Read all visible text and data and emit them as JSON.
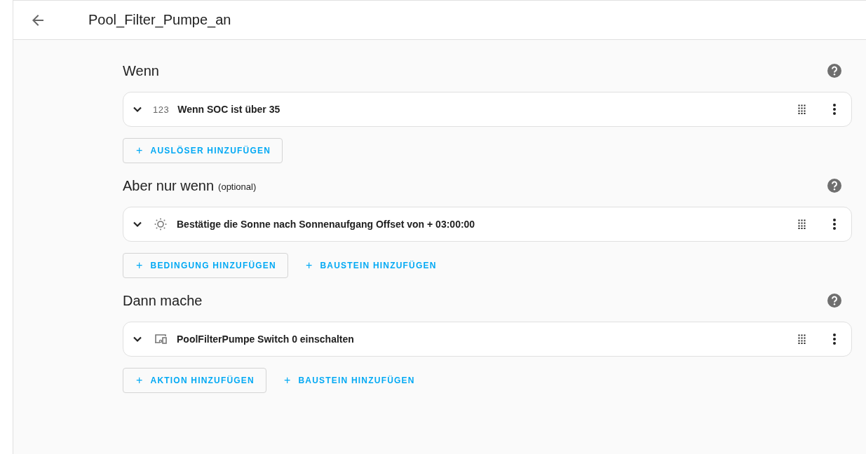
{
  "header": {
    "title": "Pool_Filter_Pumpe_an"
  },
  "sections": [
    {
      "heading": "Wenn",
      "rows": [
        {
          "kind": "numeric",
          "icon_text": "123",
          "label": "Wenn SOC ist über 35"
        }
      ],
      "buttons": [
        {
          "kind": "outlined",
          "label": "+",
          "text": "AUSLÖSER HINZUFÜGEN"
        }
      ]
    },
    {
      "heading": "Aber nur wenn",
      "note": "(optional)",
      "rows": [
        {
          "kind": "sun",
          "label": "Bestätige die Sonne nach Sonnenaufgang Offset von + 03:00:00"
        }
      ],
      "buttons": [
        {
          "kind": "outlined",
          "label": "+",
          "text": "BEDINGUNG HINZUFÜGEN"
        },
        {
          "kind": "text",
          "label": "+",
          "text": "BAUSTEIN HINZUFÜGEN"
        }
      ]
    },
    {
      "heading": "Dann mache",
      "rows": [
        {
          "kind": "device",
          "label": "PoolFilterPumpe Switch 0 einschalten"
        }
      ],
      "buttons": [
        {
          "kind": "outlined",
          "label": "+",
          "text": "AKTION HINZUFÜGEN"
        },
        {
          "kind": "text",
          "label": "+",
          "text": "BAUSTEIN HINZUFÜGEN"
        }
      ]
    }
  ]
}
